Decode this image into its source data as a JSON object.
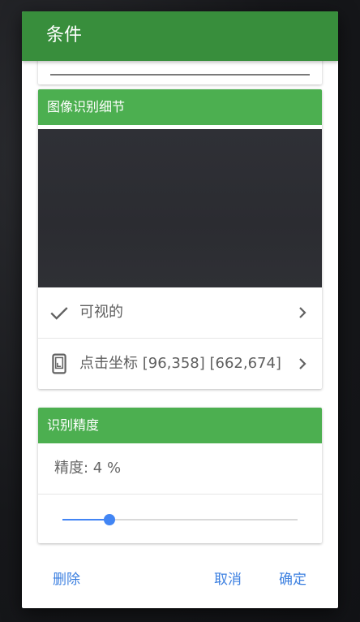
{
  "dialog": {
    "title": "条件"
  },
  "image_card": {
    "header": "图像识别细节",
    "rows": [
      {
        "icon": "check-icon",
        "label": "可视的"
      },
      {
        "icon": "phone-icon",
        "label": "点击坐标 [96,358] [662,674]"
      }
    ]
  },
  "precision_card": {
    "header": "识别精度",
    "text": "精度: 4 %",
    "slider_value_percent": 20
  },
  "footer": {
    "delete_label": "删除",
    "cancel_label": "取消",
    "confirm_label": "确定"
  },
  "colors": {
    "header_dark_green": "#388e3c",
    "card_header_green": "#4caf50",
    "accent_blue": "#4285f4",
    "button_blue": "#3b7fe0"
  }
}
